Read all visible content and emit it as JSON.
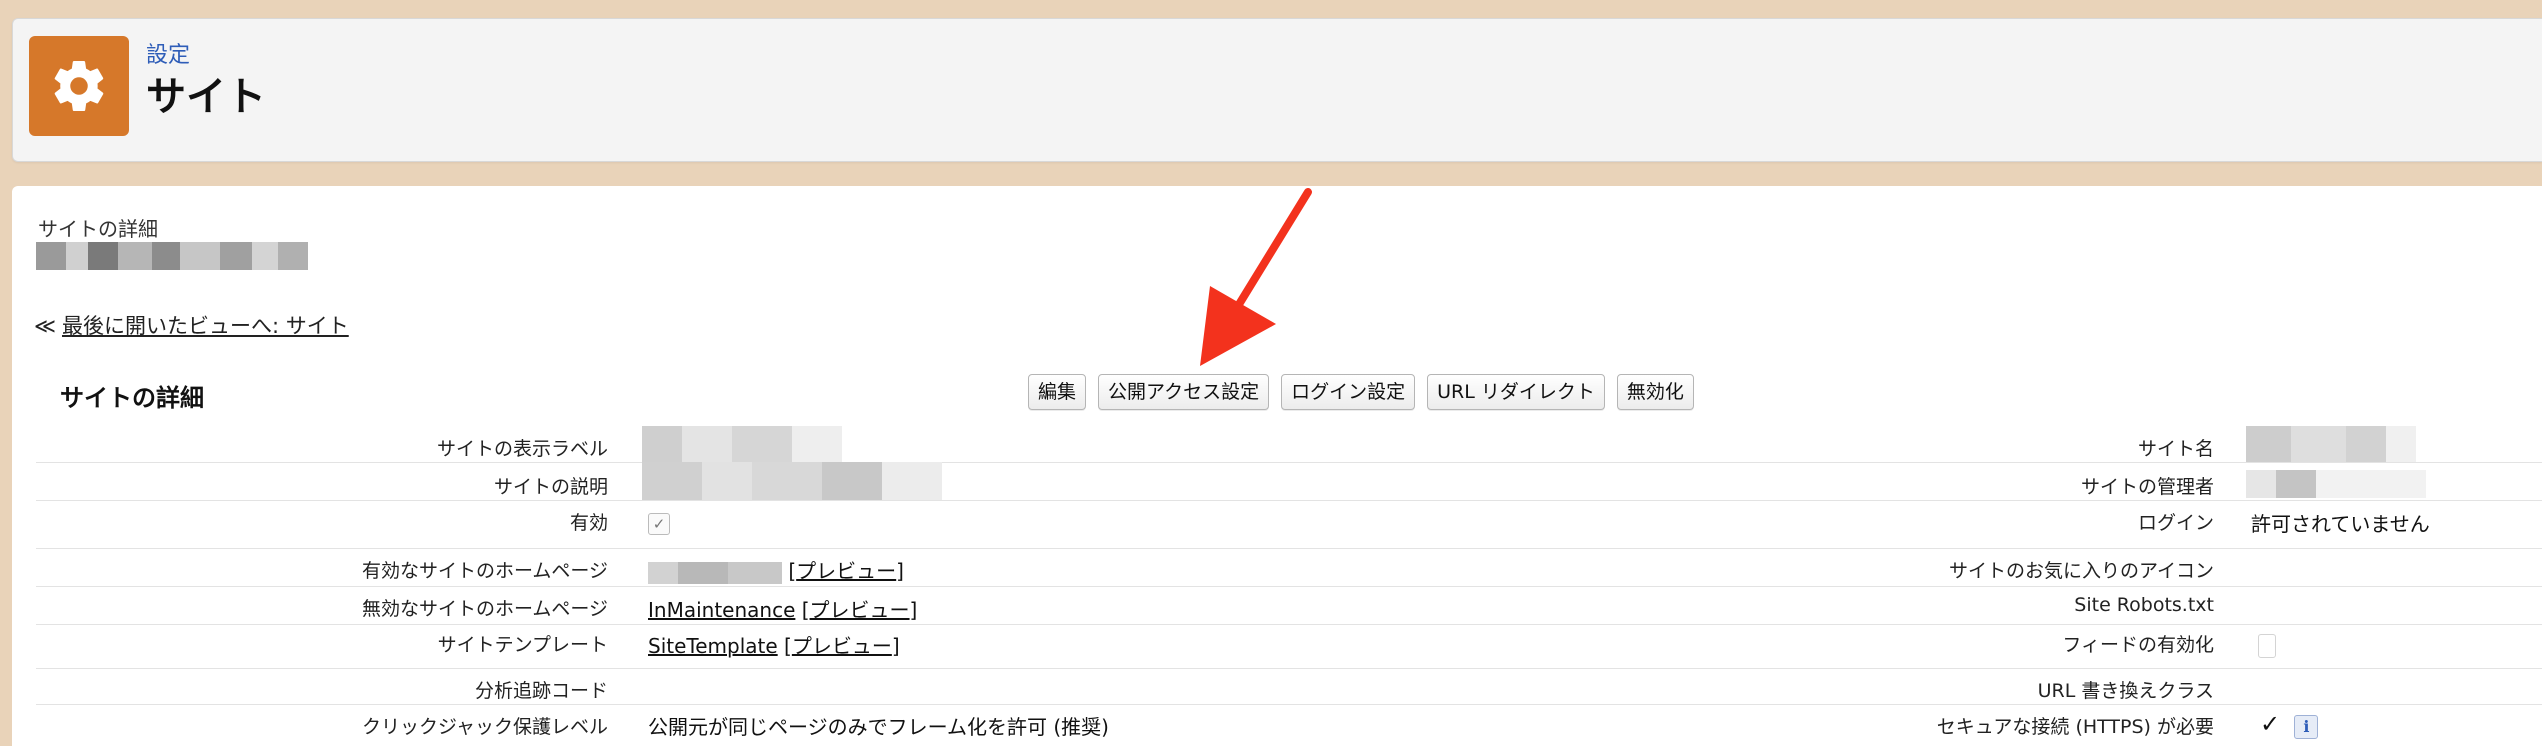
{
  "header": {
    "breadcrumb": "設定",
    "title": "サイト"
  },
  "detail": {
    "label": "サイトの詳細"
  },
  "back_link": {
    "arrow": "≪",
    "text": "最後に開いたビューへ: サイト"
  },
  "section_title": "サイトの詳細",
  "buttons": [
    "編集",
    "公開アクセス設定",
    "ログイン設定",
    "URL リダイレクト",
    "無効化"
  ],
  "fields_left": {
    "site_label": "サイトの表示ラベル",
    "site_desc": "サイトの説明",
    "active": "有効",
    "active_home": "有効なサイトのホームページ",
    "inactive_home": "無効なサイトのホームページ",
    "template": "サイトテンプレート",
    "analytics": "分析追跡コード",
    "clickjack": "クリックジャック保護レベル"
  },
  "fields_right": {
    "site_name": "サイト名",
    "site_admin": "サイトの管理者",
    "login": "ログイン",
    "favicon": "サイトのお気に入りのアイコン",
    "robots": "Site Robots.txt",
    "feeds": "フィードの有効化",
    "url_rewrite": "URL 書き換えクラス",
    "https": "セキュアな接続 (HTTPS) が必要"
  },
  "values": {
    "active_checked": "✓",
    "preview_link": "プレビュー",
    "inactive_home_page": "InMaintenance",
    "template_page": "SiteTemplate",
    "clickjack_value": "公開元が同じページのみでフレーム化を許可 (推奨)",
    "login_value": "許可されていません",
    "https_check": "✓",
    "info_glyph": "i"
  },
  "colors": {
    "header_bg": "#f4f4f4",
    "gear_bg": "#d6782a",
    "link_blue": "#2e5db8",
    "arrow_red": "#f3321d",
    "page_bg": "#e9d3b9"
  },
  "icons": {
    "header_icon": "gear-icon",
    "annotation": "red-arrow-icon"
  }
}
